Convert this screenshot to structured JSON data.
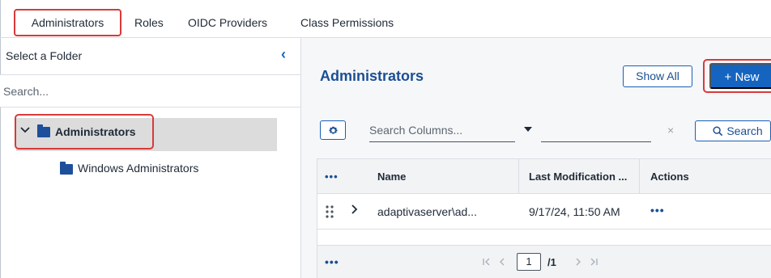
{
  "tabs": [
    {
      "label": "Administrators"
    },
    {
      "label": "Roles"
    },
    {
      "label": "OIDC Providers"
    },
    {
      "label": "Class Permissions"
    }
  ],
  "sidebar": {
    "title": "Select a Folder",
    "search_placeholder": "Search...",
    "tree": [
      {
        "label": "Administrators",
        "expanded": true,
        "selected": true
      },
      {
        "label": "Windows Administrators"
      }
    ]
  },
  "main": {
    "title": "Administrators",
    "show_all_label": "Show All",
    "new_label": "+ New",
    "search_columns_placeholder": "Search Columns...",
    "clear_symbol": "×",
    "search_label": "Search",
    "grid": {
      "more_symbol": "•••",
      "columns": [
        "Name",
        "Last Modification ...",
        "Actions"
      ],
      "rows": [
        {
          "name": "adaptivaserver\\ad...",
          "last_modified": "9/17/24, 11:50 AM",
          "actions": "•••"
        }
      ],
      "pagination": {
        "current_page": "1",
        "total": "/1"
      }
    }
  },
  "colors": {
    "accent": "#1565c0",
    "highlight": "#d93a3a",
    "folder": "#1e4f9a"
  }
}
